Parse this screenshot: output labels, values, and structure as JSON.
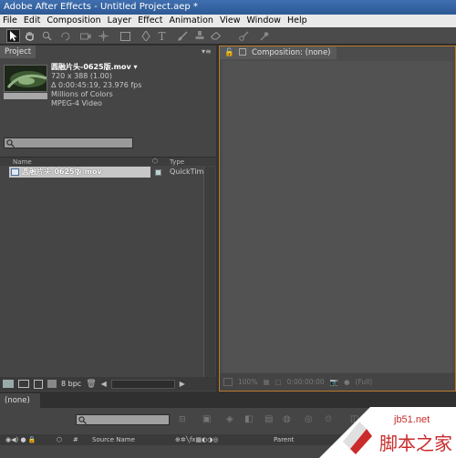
{
  "window": {
    "title": "Adobe After Effects - Untitled Project.aep *"
  },
  "menu": [
    "File",
    "Edit",
    "Composition",
    "Layer",
    "Effect",
    "Animation",
    "View",
    "Window",
    "Help"
  ],
  "project_panel": {
    "tab_label": "Project",
    "file": {
      "name": "圆融片头-0625版.mov ▾",
      "dimensions": "720 x 388 (1.00)",
      "duration": "Δ 0:00:45:19, 23.976 fps",
      "colors": "Millions of Colors",
      "codec": "MPEG-4 Video"
    },
    "search_placeholder": "",
    "columns": {
      "name": "Name",
      "type": "Type"
    },
    "items": [
      {
        "name": "圆融片头-0625版.mov",
        "type": "QuickTime"
      }
    ],
    "bit_depth": "8 bpc"
  },
  "composition_panel": {
    "tab_label": "Composition: (none)",
    "zoom": "100%",
    "timecode": "0:00:00:00",
    "resolution": "(Full)"
  },
  "timeline": {
    "tab_label": "(none)",
    "columns": {
      "source_name": "Source Name",
      "parent": "Parent"
    }
  },
  "watermark": {
    "site": "jb51.net",
    "text": "脚本之家"
  },
  "colors": {
    "title_bar": "#2d5994",
    "highlight_border": "#b87a2a",
    "selected_row": "#c7c7c7"
  }
}
